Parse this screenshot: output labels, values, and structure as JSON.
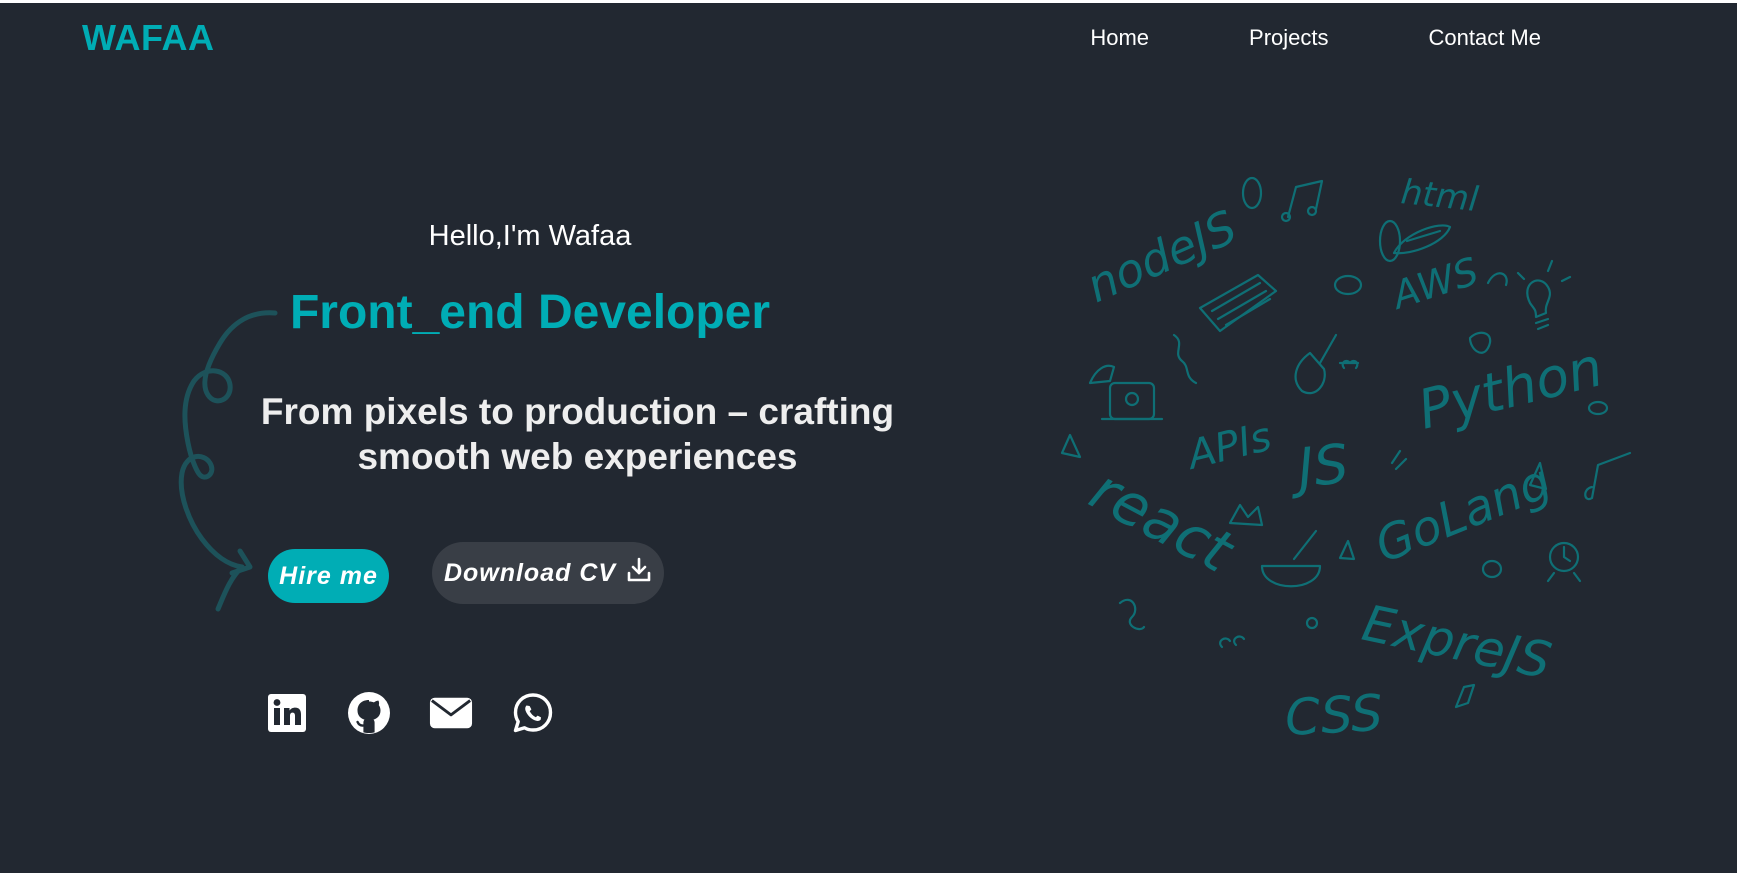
{
  "header": {
    "logo": "WAFAA",
    "nav": [
      {
        "label": "Home"
      },
      {
        "label": "Projects"
      },
      {
        "label": "Contact Me"
      }
    ]
  },
  "hero": {
    "greeting": "Hello,I'm Wafaa",
    "role": "Front_end Developer",
    "tagline": "From pixels to production – crafting smooth web experiences",
    "hire_label": "Hire me",
    "cv_label": "Download CV"
  },
  "socials": [
    {
      "icon": "linkedin-icon"
    },
    {
      "icon": "github-icon"
    },
    {
      "icon": "mail-icon"
    },
    {
      "icon": "whatsapp-icon"
    }
  ],
  "doodle": {
    "words": [
      "html",
      "nodeJS",
      "AWS",
      "Python",
      "APIs",
      "JS",
      "react",
      "GoLang",
      "ExpreJS",
      "CSS"
    ]
  },
  "colors": {
    "background": "#222831",
    "accent": "#00adb5",
    "secondary_button": "#393e46",
    "text": "#ffffff",
    "doodle": "#0f6f75"
  }
}
